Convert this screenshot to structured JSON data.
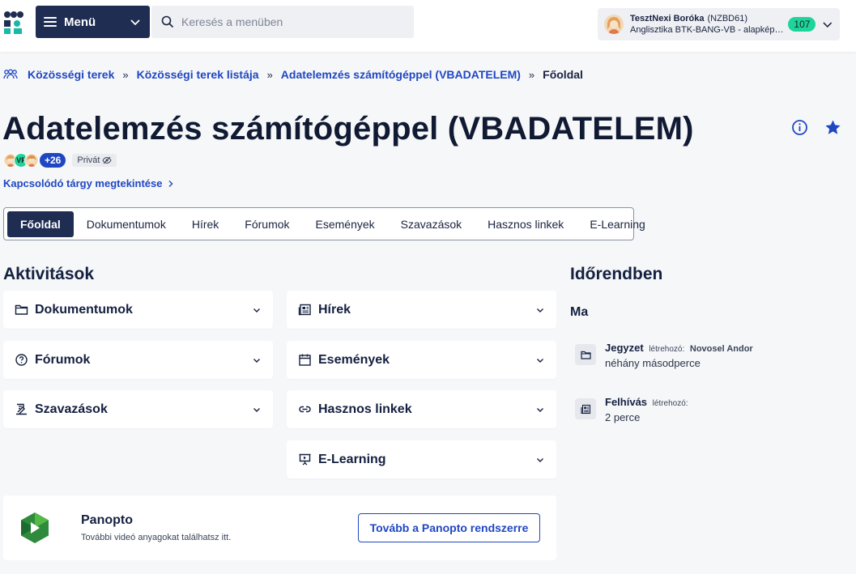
{
  "header": {
    "menu_label": "Menü",
    "search_placeholder": "Keresés a menüben",
    "user": {
      "name": "TesztNexi Boróka",
      "code": "(NZBD61)",
      "program": "Anglisztika BTK-BANG-VB - alapképzés (BA)",
      "count": "107"
    }
  },
  "breadcrumb": {
    "items": [
      "Közösségi terek",
      "Közösségi terek listája",
      "Adatelemzés számítógéppel (VBADATELEM)"
    ],
    "current": "Főoldal",
    "separator": "»"
  },
  "page": {
    "title": "Adatelemzés számítógéppel (VBADATELEM)",
    "member_initials": "VF",
    "more_members": "+26",
    "privacy_label": "Privát",
    "related_link": "Kapcsolódó tárgy megtekintése"
  },
  "tabs": [
    "Főoldal",
    "Dokumentumok",
    "Hírek",
    "Fórumok",
    "Események",
    "Szavazások",
    "Hasznos linkek",
    "E-Learning"
  ],
  "activities": {
    "title": "Aktivitások",
    "left": [
      "Dokumentumok",
      "Fórumok",
      "Szavazások"
    ],
    "right": [
      "Hírek",
      "Események",
      "Hasznos linkek",
      "E-Learning"
    ]
  },
  "panopto": {
    "title": "Panopto",
    "subtitle": "További videó anyagokat találhatsz itt.",
    "button": "Tovább a Panopto rendszerre"
  },
  "timeline": {
    "title": "Időrendben",
    "today": "Ma",
    "items": [
      {
        "type": "Jegyzet",
        "by_label": "létrehozó:",
        "author": "Novosel Andor",
        "time": "néhány másodperce",
        "icon": "folder-icon"
      },
      {
        "type": "Felhívás",
        "by_label": "létrehozó:",
        "author": "",
        "time": "2 perce",
        "icon": "news-icon"
      }
    ]
  },
  "colors": {
    "navy": "#1f2d52",
    "link_blue": "#1f47c2",
    "count_green": "#1ed49a",
    "logo_teal": "#1ab8a6"
  }
}
